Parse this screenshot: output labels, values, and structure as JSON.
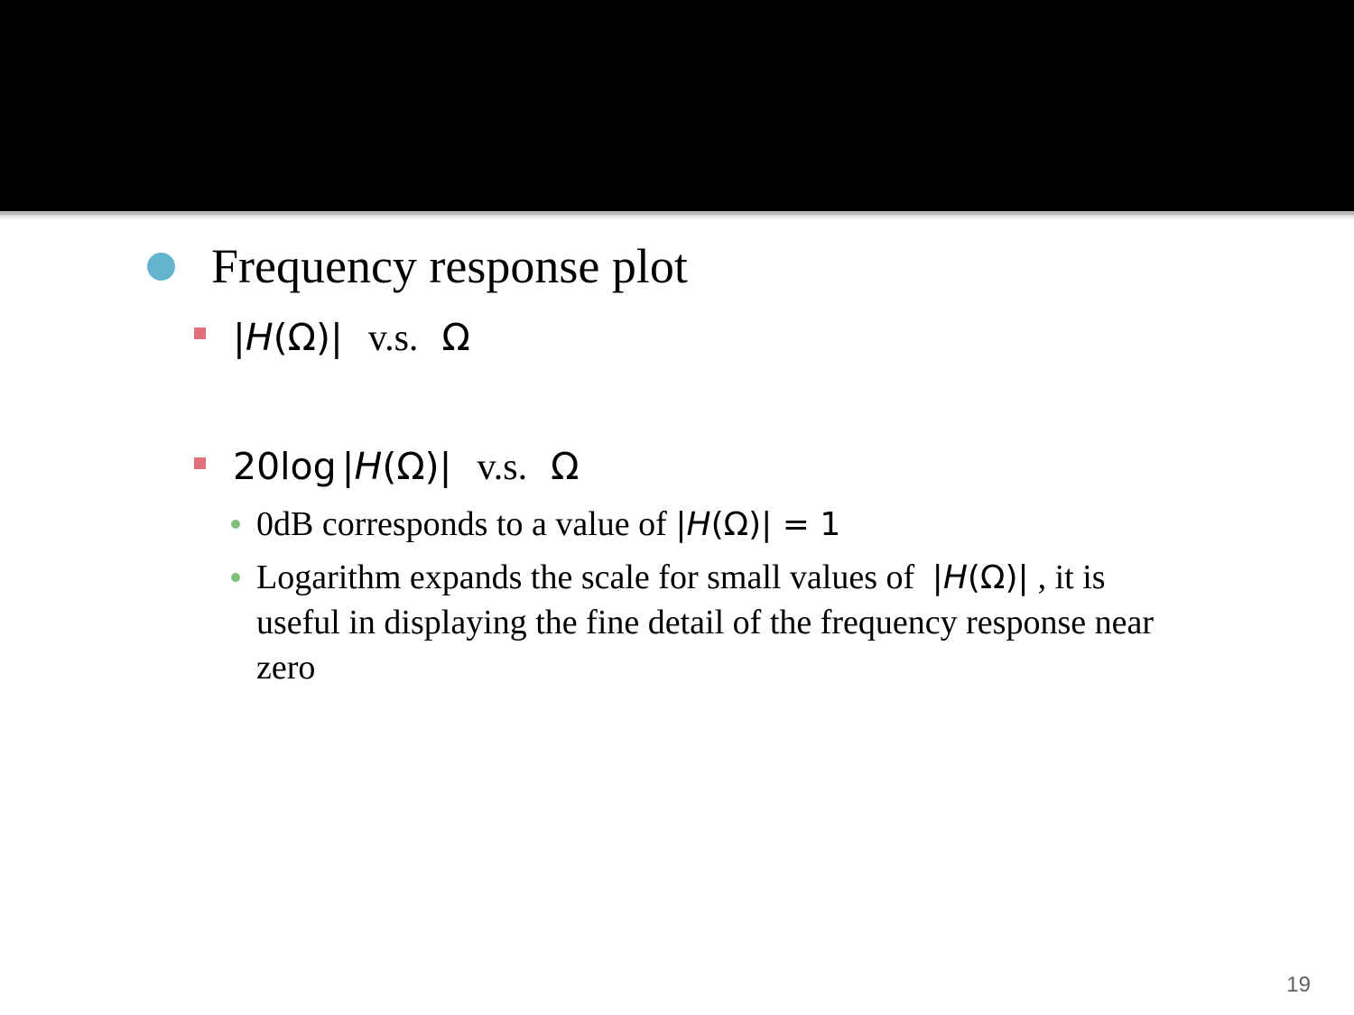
{
  "slide": {
    "page_number": "19",
    "colors": {
      "title_bar": "#000000",
      "level1_bullet": "#63b4cf",
      "level2_bullet": "#e2707c",
      "level3_bullet": "#7cbf7a"
    },
    "bullets": {
      "level1": "Frequency response plot",
      "item1": {
        "math_open": "|",
        "math_var": "H",
        "math_rest": "(Ω)|",
        "vs": "v.s.",
        "omega": "Ω"
      },
      "item2": {
        "prefix": "20log",
        "math_open": "|",
        "math_var": "H",
        "math_rest": "(Ω)|",
        "vs": "v.s.",
        "omega": "Ω",
        "sub1": {
          "text": "0dB corresponds to a value of ",
          "math_open": "|",
          "math_var": "H",
          "math_rest": "(Ω)| = 1"
        },
        "sub2": {
          "text_before": "Logarithm expands the scale for small values of ",
          "math_open": "|",
          "math_var": "H",
          "math_rest": "(Ω)|",
          "text_after": ", it is",
          "line2": "useful in displaying the fine detail of the frequency response near",
          "line3": "zero"
        }
      }
    }
  }
}
